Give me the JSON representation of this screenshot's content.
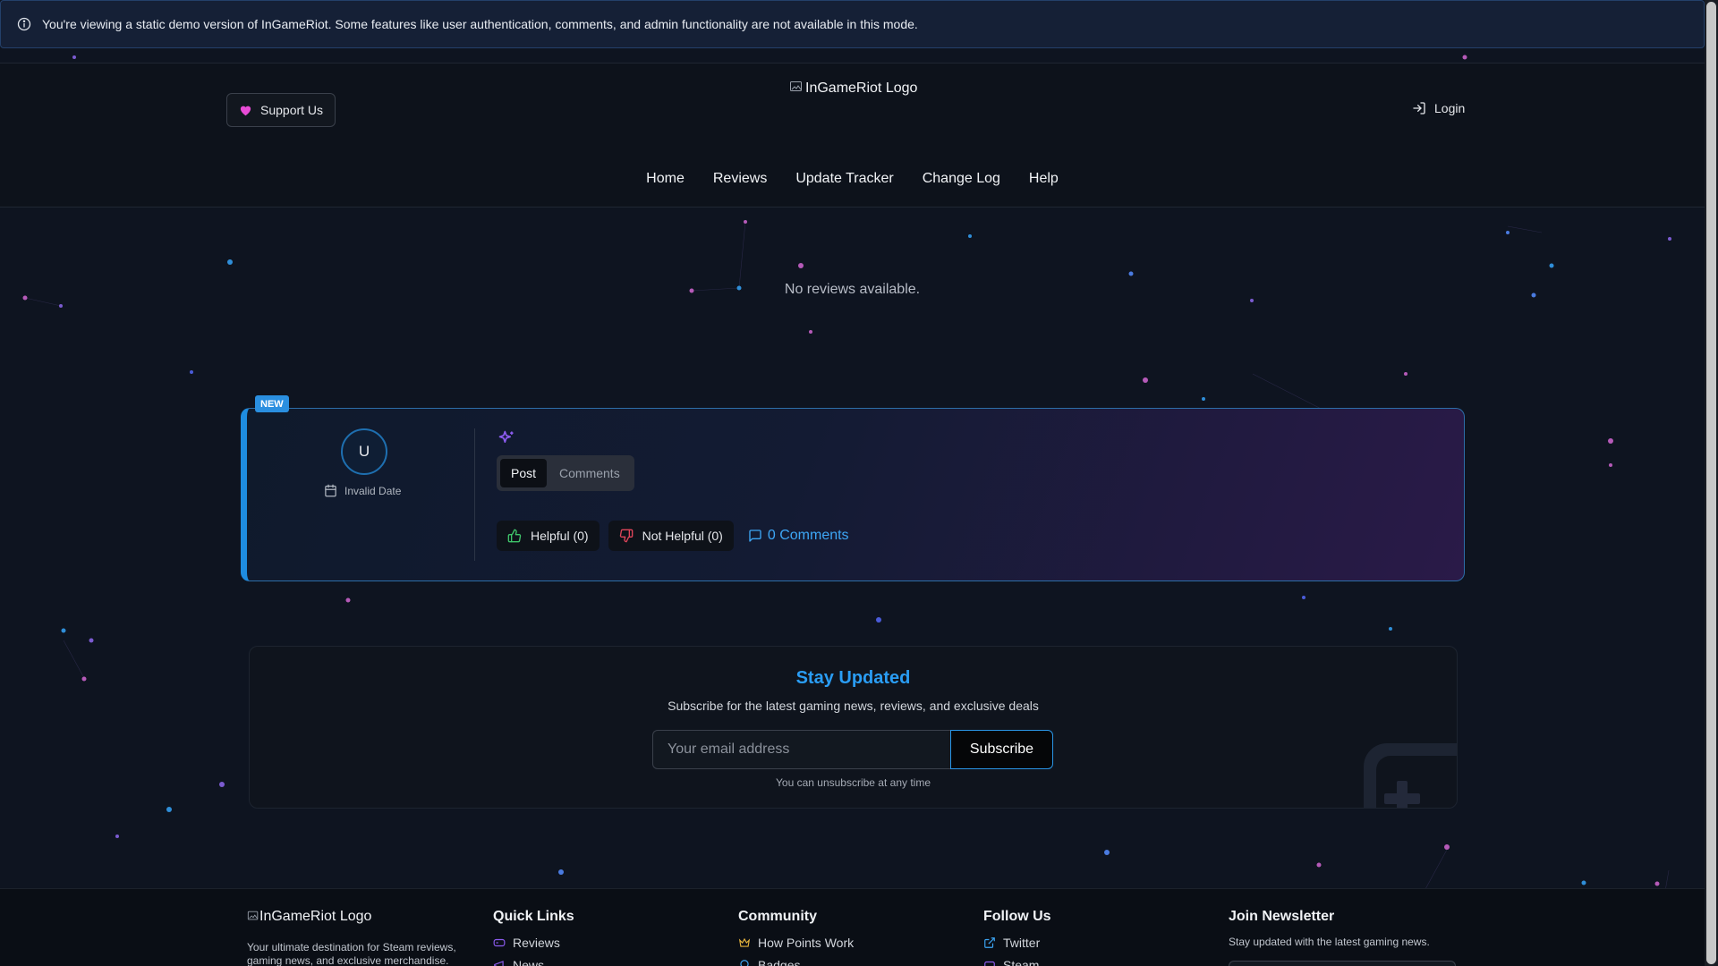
{
  "banner": {
    "text": "You're viewing a static demo version of InGameRiot. Some features like user authentication, comments, and admin functionality are not available in this mode.",
    "icon": "info-icon"
  },
  "header": {
    "support_label": "Support Us",
    "logo_alt": "InGameRiot Logo",
    "login_label": "Login",
    "nav": [
      "Home",
      "Reviews",
      "Update Tracker",
      "Change Log",
      "Help"
    ]
  },
  "main": {
    "empty_text": "No reviews available."
  },
  "review_card": {
    "badge": "NEW",
    "avatar_initial": "U",
    "date": "Invalid Date",
    "tabs": [
      "Post",
      "Comments"
    ],
    "active_tab": "Post",
    "helpful_label": "Helpful (0)",
    "not_helpful_label": "Not Helpful (0)",
    "comments_label": "0 Comments"
  },
  "newsletter": {
    "title": "Stay Updated",
    "subtitle": "Subscribe for the latest gaming news, reviews, and exclusive deals",
    "placeholder": "Your email address",
    "button": "Subscribe",
    "note": "You can unsubscribe at any time"
  },
  "footer": {
    "logo_alt": "InGameRiot Logo",
    "description": "Your ultimate destination for Steam reviews, gaming news, and exclusive merchandise.",
    "quick_links": {
      "title": "Quick Links",
      "items": [
        "Reviews",
        "News"
      ]
    },
    "community": {
      "title": "Community",
      "items": [
        "How Points Work",
        "Badges"
      ]
    },
    "follow": {
      "title": "Follow Us",
      "items": [
        "Twitter",
        "Steam"
      ]
    },
    "newsletter": {
      "title": "Join Newsletter",
      "description": "Stay updated with the latest gaming news."
    }
  },
  "colors": {
    "accent": "#2a9df4",
    "card_border": "#1e8ce0",
    "heart": "#e84bd6",
    "background": "#0e1420"
  }
}
